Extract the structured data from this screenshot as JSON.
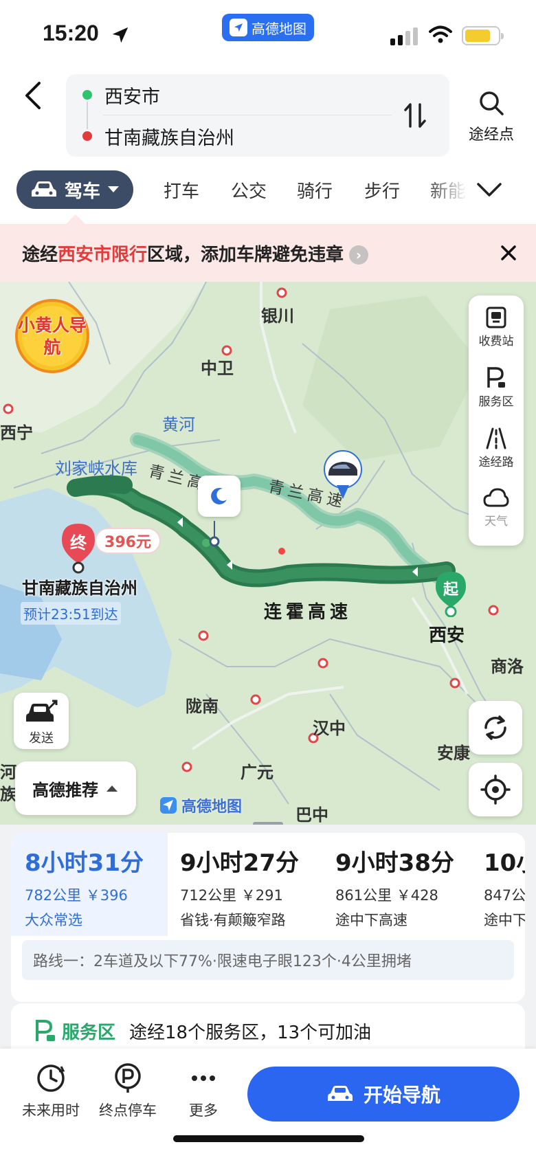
{
  "status_bar": {
    "time": "15:20",
    "app_name": "高德地图"
  },
  "route": {
    "origin": "西安市",
    "destination": "甘南藏族自治州",
    "waypoint_label": "途经点"
  },
  "tabs": {
    "active": "驾车",
    "items": [
      "打车",
      "公交",
      "骑行",
      "步行",
      "新能"
    ]
  },
  "banner": {
    "prefix": "途经",
    "highlight": "西安市限行",
    "suffix": "区域，添加车牌避免违章"
  },
  "map": {
    "badge": "小黄人导航",
    "cities": {
      "yinchuan": "银川",
      "zhongwei": "中卫",
      "xining": "西宁",
      "huanghe": "黄河",
      "liujiaxia": "刘家峡水库",
      "longnan": "陇南",
      "hanzhong": "汉中",
      "guangyuan": "广元",
      "bazhong": "巴中",
      "ankang": "安康",
      "shangluo": "商洛",
      "he_edge": "河",
      "zu_edge": "族"
    },
    "roads": {
      "lianhuo": "连霍高速",
      "qinglan_1": "青兰高速",
      "qinglan_2": "青兰高"
    },
    "tools": [
      {
        "label": "收费站",
        "icon": "toll-station-icon"
      },
      {
        "label": "服务区",
        "icon": "service-area-icon"
      },
      {
        "label": "途经路",
        "icon": "via-road-icon"
      },
      {
        "label": "天气",
        "icon": "weather-icon"
      }
    ],
    "end_pin_label": "终",
    "start_pin_label": "起",
    "cost": "396元",
    "destination_name": "甘南藏族自治州",
    "eta": "预计23:51到达",
    "start_name": "西安",
    "send_label": "发送",
    "recommend_label": "高德推荐",
    "logo_text": "高德地图"
  },
  "routes": [
    {
      "time": "8小时31分",
      "meta": "782公里 ￥396",
      "tag": "大众常选",
      "active": true
    },
    {
      "time": "9小时27分",
      "meta": "712公里 ￥291",
      "tag": "省钱·有颠簸窄路",
      "active": false
    },
    {
      "time": "9小时38分",
      "meta": "861公里 ￥428",
      "tag": "途中下高速",
      "active": false
    },
    {
      "time": "10小",
      "meta": "847公",
      "tag": "途中下",
      "active": false
    }
  ],
  "route_info": "路线一：2车道及以下77%·限速电子眼123个·4公里拥堵",
  "service": {
    "title": "服务区",
    "text": "途经18个服务区，13个可加油"
  },
  "bottom_bar": {
    "future_time": "未来用时",
    "end_parking": "终点停车",
    "more": "更多",
    "start_nav": "开始导航"
  },
  "colors": {
    "accent": "#2b66f0",
    "route_main": "#2f8a57",
    "route_alt": "#7fc7a7",
    "banner_bg": "#fde8e8",
    "highlight": "#e23b3b"
  }
}
